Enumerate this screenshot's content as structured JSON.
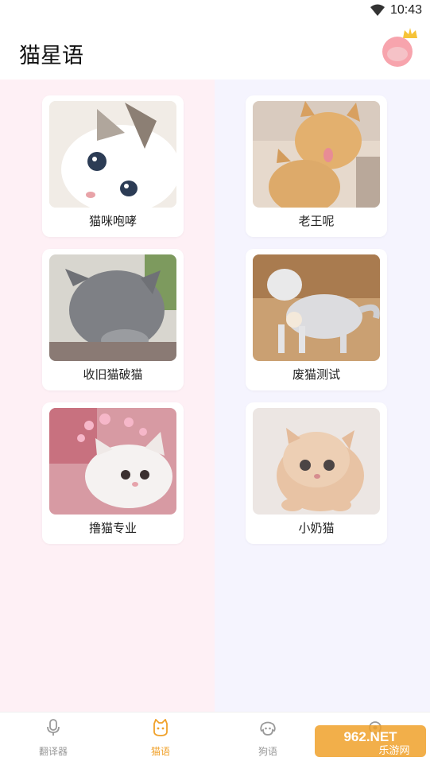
{
  "status_bar": {
    "time": "10:43",
    "wifi_icon": "wifi-icon"
  },
  "app_bar": {
    "title": "猫星语",
    "avatar_icon": "pig-avatar-with-crown-icon"
  },
  "cards": [
    {
      "label": "猫咪咆哮",
      "image": "kitten-blue-eyes-photo"
    },
    {
      "label": "老王呢",
      "image": "two-orange-cats-photo"
    },
    {
      "label": "收旧猫破猫",
      "image": "grey-cat-hiding-photo"
    },
    {
      "label": "废猫测试",
      "image": "silver-tabby-cat-photo"
    },
    {
      "label": "撸猫专业",
      "image": "white-kitten-hearts-photo"
    },
    {
      "label": "小奶猫",
      "image": "fluffy-orange-kitten-photo"
    }
  ],
  "tabs": [
    {
      "label": "翻译器",
      "icon": "microphone-icon",
      "active": false
    },
    {
      "label": "猫语",
      "icon": "cat-face-icon",
      "active": true
    },
    {
      "label": "狗语",
      "icon": "dog-face-icon",
      "active": false
    },
    {
      "label": "",
      "icon": "settings-icon",
      "active": false
    }
  ],
  "watermark": {
    "text_top": "962.NET",
    "text_bottom": "乐游网"
  },
  "colors": {
    "accent": "#f0a12a",
    "left_bg": "#fef0f5",
    "right_bg": "#f5f4fe"
  }
}
